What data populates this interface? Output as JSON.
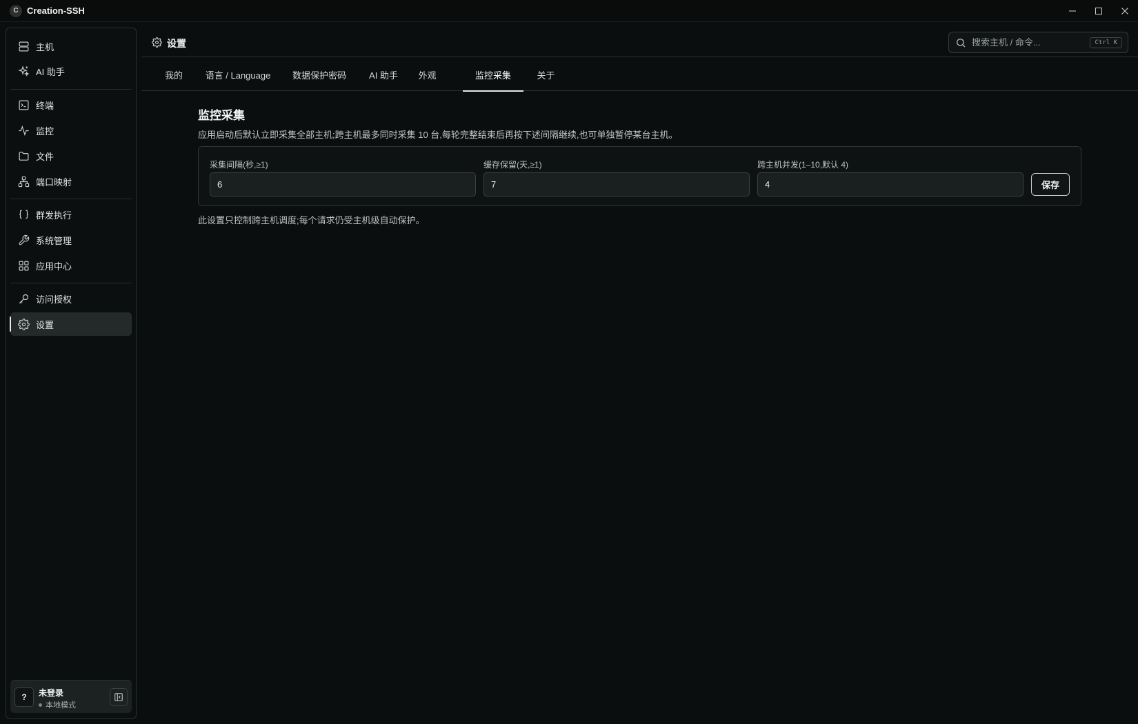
{
  "app": {
    "logo_letter": "C",
    "title": "Creation-SSH"
  },
  "sidebar": {
    "items": [
      {
        "label": "主机",
        "icon": "server-icon"
      },
      {
        "label": "AI 助手",
        "icon": "sparkles-icon"
      },
      {
        "label": "终端",
        "icon": "terminal-icon"
      },
      {
        "label": "监控",
        "icon": "activity-icon"
      },
      {
        "label": "文件",
        "icon": "folder-icon"
      },
      {
        "label": "端口映射",
        "icon": "network-icon"
      },
      {
        "label": "群发执行",
        "icon": "braces-icon"
      },
      {
        "label": "系统管理",
        "icon": "wrench-icon"
      },
      {
        "label": "应用中心",
        "icon": "grid-icon"
      },
      {
        "label": "访问授权",
        "icon": "key-icon"
      },
      {
        "label": "设置",
        "icon": "gear-icon",
        "active": true
      }
    ],
    "account": {
      "avatar": "?",
      "name": "未登录",
      "mode": "本地模式"
    }
  },
  "header": {
    "title": "设置",
    "search": {
      "placeholder": "搜索主机 / 命令...",
      "shortcut": "Ctrl K"
    }
  },
  "tabs": [
    {
      "label": "我的"
    },
    {
      "label": "语言 / Language"
    },
    {
      "label": "数据保护密码"
    },
    {
      "label": "AI 助手"
    },
    {
      "label": "外观"
    },
    {
      "label": "监控采集",
      "active": true
    },
    {
      "label": "关于"
    }
  ],
  "monitor": {
    "title": "监控采集",
    "description": "应用启动后默认立即采集全部主机;跨主机最多同时采集 10 台,每轮完整结束后再按下述间隔继续,也可单独暂停某台主机。",
    "fields": {
      "interval": {
        "label": "采集间隔(秒,≥1)",
        "value": "6"
      },
      "retention": {
        "label": "缓存保留(天,≥1)",
        "value": "7"
      },
      "concurrency": {
        "label": "跨主机并发(1–10,默认 4)",
        "value": "4"
      }
    },
    "save_label": "保存",
    "footnote": "此设置只控制跨主机调度;每个请求仍受主机级自动保护。"
  }
}
